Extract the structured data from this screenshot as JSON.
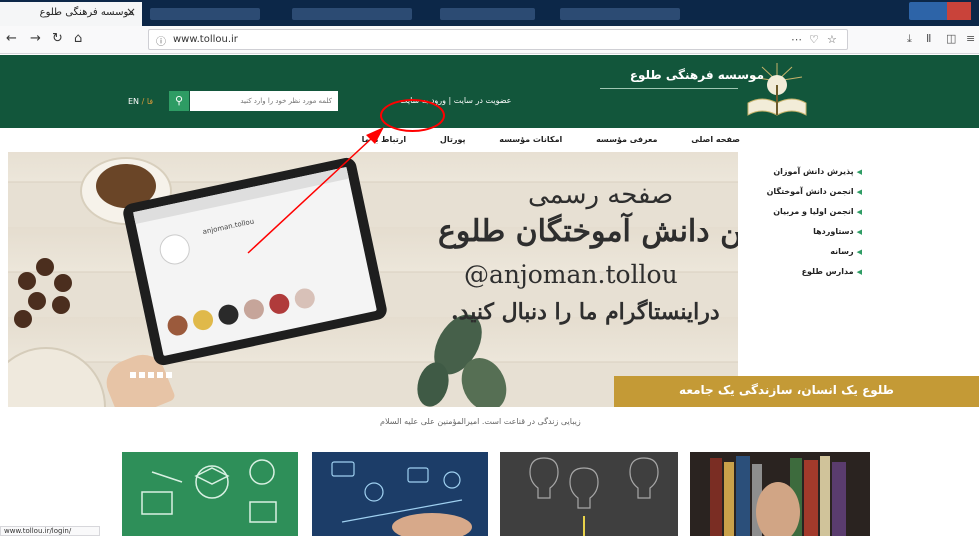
{
  "browser": {
    "active_tab_title": "موسسه فرهنگی طلوع",
    "tab_close": "×",
    "url": "www.tollou.ir",
    "status_url": "www.tollou.ir/login/"
  },
  "header": {
    "site_name": "موسسه فرهنگی طلوع",
    "user_links": "عضویت در سایت | ورود به سایت",
    "search_placeholder": "کلمه مورد نظر خود را وارد کنید",
    "lang_en": "EN",
    "lang_sep": "/",
    "lang_fa": "فا"
  },
  "main_nav": [
    "صفحه اصلی",
    "معرفی مؤسسه",
    "امکانات مؤسسه",
    "پورتال",
    "ارتباط با ما"
  ],
  "sidebar": {
    "items": [
      "پذیرش دانش آموزان",
      "انجمن دانش آموختگان",
      "انجمن اولیا و مربیان",
      "دستاوردها",
      "رسانه",
      "مدارس طلوع"
    ]
  },
  "banner": {
    "line1": "صفحه رسمی",
    "line2": "انجمن دانش آموختگان طلوع",
    "handle": "@anjoman.tollou",
    "line3": "دراینستاگرام ما را دنبال کنید.",
    "tablet_handle": "anjoman.tollou"
  },
  "slogan": "طلوع یک انسان، سازندگی یک جامعه",
  "quote": "زیبایی زندگی در قناعت است. امیرالمؤمنین علی علیه السلام",
  "colors": {
    "header_green": "#12563b",
    "search_button": "#2e9c64",
    "gold": "#c49a36",
    "annotation_red": "#ff0000"
  }
}
